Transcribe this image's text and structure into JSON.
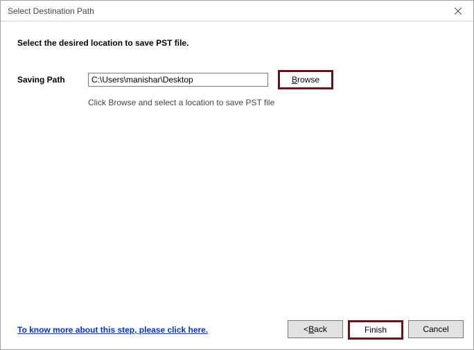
{
  "titlebar": {
    "title": "Select Destination Path"
  },
  "heading": "Select the desired location to save PST file.",
  "savingPath": {
    "label": "Saving Path",
    "value": "C:\\Users\\manishar\\Desktop",
    "browse": {
      "prefix": "B",
      "rest": "rowse"
    },
    "hint": "Click Browse and select a location to save PST file"
  },
  "footer": {
    "helpLink": "To know more about this step, please click here.",
    "back": {
      "prefix": "< ",
      "underline": "B",
      "rest": "ack"
    },
    "finish": "Finish",
    "cancel": "Cancel"
  }
}
